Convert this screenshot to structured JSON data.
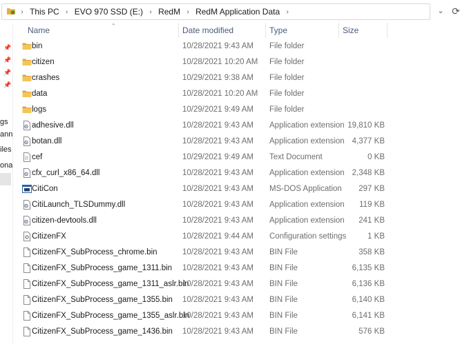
{
  "address": {
    "crumbs": [
      "This PC",
      "EVO 970 SSD (E:)",
      "RedM",
      "RedM Application Data"
    ]
  },
  "nav": {
    "fragments": [
      "gs",
      "anne",
      "iles",
      "onal"
    ]
  },
  "columns": {
    "name": "Name",
    "date": "Date modified",
    "type": "Type",
    "size": "Size"
  },
  "files": [
    {
      "name": "bin",
      "date": "10/28/2021 9:43 AM",
      "type": "File folder",
      "size": "",
      "icon": "folder-icon"
    },
    {
      "name": "citizen",
      "date": "10/28/2021 10:20 AM",
      "type": "File folder",
      "size": "",
      "icon": "folder-icon"
    },
    {
      "name": "crashes",
      "date": "10/29/2021 9:38 AM",
      "type": "File folder",
      "size": "",
      "icon": "folder-icon"
    },
    {
      "name": "data",
      "date": "10/28/2021 10:20 AM",
      "type": "File folder",
      "size": "",
      "icon": "folder-icon"
    },
    {
      "name": "logs",
      "date": "10/29/2021 9:49 AM",
      "type": "File folder",
      "size": "",
      "icon": "folder-icon"
    },
    {
      "name": "adhesive.dll",
      "date": "10/28/2021 9:43 AM",
      "type": "Application extension",
      "size": "19,810 KB",
      "icon": "dll-icon"
    },
    {
      "name": "botan.dll",
      "date": "10/28/2021 9:43 AM",
      "type": "Application extension",
      "size": "4,377 KB",
      "icon": "dll-icon"
    },
    {
      "name": "cef",
      "date": "10/29/2021 9:49 AM",
      "type": "Text Document",
      "size": "0 KB",
      "icon": "text-document-icon"
    },
    {
      "name": "cfx_curl_x86_64.dll",
      "date": "10/28/2021 9:43 AM",
      "type": "Application extension",
      "size": "2,348 KB",
      "icon": "dll-icon"
    },
    {
      "name": "CitiCon",
      "date": "10/28/2021 9:43 AM",
      "type": "MS-DOS Application",
      "size": "297 KB",
      "icon": "app-window-icon"
    },
    {
      "name": "CitiLaunch_TLSDummy.dll",
      "date": "10/28/2021 9:43 AM",
      "type": "Application extension",
      "size": "119 KB",
      "icon": "dll-icon"
    },
    {
      "name": "citizen-devtools.dll",
      "date": "10/28/2021 9:43 AM",
      "type": "Application extension",
      "size": "241 KB",
      "icon": "dll-icon"
    },
    {
      "name": "CitizenFX",
      "date": "10/28/2021 9:44 AM",
      "type": "Configuration settings",
      "size": "1 KB",
      "icon": "config-icon"
    },
    {
      "name": "CitizenFX_SubProcess_chrome.bin",
      "date": "10/28/2021 9:43 AM",
      "type": "BIN File",
      "size": "358 KB",
      "icon": "file-icon"
    },
    {
      "name": "CitizenFX_SubProcess_game_1311.bin",
      "date": "10/28/2021 9:43 AM",
      "type": "BIN File",
      "size": "6,135 KB",
      "icon": "file-icon"
    },
    {
      "name": "CitizenFX_SubProcess_game_1311_aslr.bin",
      "date": "10/28/2021 9:43 AM",
      "type": "BIN File",
      "size": "6,136 KB",
      "icon": "file-icon"
    },
    {
      "name": "CitizenFX_SubProcess_game_1355.bin",
      "date": "10/28/2021 9:43 AM",
      "type": "BIN File",
      "size": "6,140 KB",
      "icon": "file-icon"
    },
    {
      "name": "CitizenFX_SubProcess_game_1355_aslr.bin",
      "date": "10/28/2021 9:43 AM",
      "type": "BIN File",
      "size": "6,141 KB",
      "icon": "file-icon"
    },
    {
      "name": "CitizenFX_SubProcess_game_1436.bin",
      "date": "10/28/2021 9:43 AM",
      "type": "BIN File",
      "size": "576 KB",
      "icon": "file-icon"
    }
  ]
}
